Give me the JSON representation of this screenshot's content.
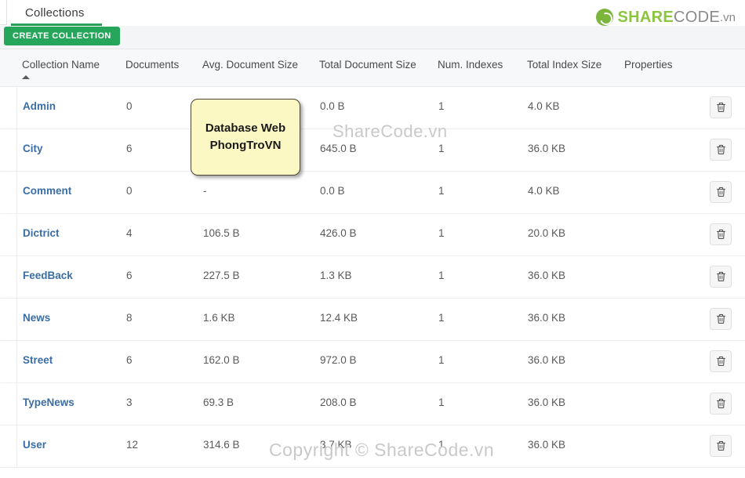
{
  "tab": {
    "label": "Collections"
  },
  "logo": {
    "mark": "sharecode-logo-icon",
    "share": "SHARE",
    "code": "CODE",
    "vn": ".vn",
    "green": "#8cc63e",
    "gray": "#8a8a8a"
  },
  "toolbar": {
    "create_label": "CREATE COLLECTION",
    "accent": "#26a65b"
  },
  "table": {
    "columns": [
      "Collection Name",
      "Documents",
      "Avg. Document Size",
      "Total Document Size",
      "Num. Indexes",
      "Total Index Size",
      "Properties"
    ],
    "sort": {
      "column": "Collection Name",
      "direction": "asc"
    },
    "delete_icon": "trash-icon",
    "rows": [
      {
        "name": "Admin",
        "documents": "0",
        "avg_size": "",
        "total_size": "0.0 B",
        "num_indexes": "1",
        "index_size": "4.0 KB",
        "properties": ""
      },
      {
        "name": "City",
        "documents": "6",
        "avg_size": "",
        "total_size": "645.0 B",
        "num_indexes": "1",
        "index_size": "36.0 KB",
        "properties": ""
      },
      {
        "name": "Comment",
        "documents": "0",
        "avg_size": "-",
        "total_size": "0.0 B",
        "num_indexes": "1",
        "index_size": "4.0 KB",
        "properties": ""
      },
      {
        "name": "Dictrict",
        "documents": "4",
        "avg_size": "106.5 B",
        "total_size": "426.0 B",
        "num_indexes": "1",
        "index_size": "20.0 KB",
        "properties": ""
      },
      {
        "name": "FeedBack",
        "documents": "6",
        "avg_size": "227.5 B",
        "total_size": "1.3 KB",
        "num_indexes": "1",
        "index_size": "36.0 KB",
        "properties": ""
      },
      {
        "name": "News",
        "documents": "8",
        "avg_size": "1.6 KB",
        "total_size": "12.4 KB",
        "num_indexes": "1",
        "index_size": "36.0 KB",
        "properties": ""
      },
      {
        "name": "Street",
        "documents": "6",
        "avg_size": "162.0 B",
        "total_size": "972.0 B",
        "num_indexes": "1",
        "index_size": "36.0 KB",
        "properties": ""
      },
      {
        "name": "TypeNews",
        "documents": "3",
        "avg_size": "69.3 B",
        "total_size": "208.0 B",
        "num_indexes": "1",
        "index_size": "36.0 KB",
        "properties": ""
      },
      {
        "name": "User",
        "documents": "12",
        "avg_size": "314.6 B",
        "total_size": "3.7 KB",
        "num_indexes": "1",
        "index_size": "36.0 KB",
        "properties": ""
      }
    ]
  },
  "sticky_note": {
    "text": "Database Web PhongTroVN",
    "background": "#fbf8c4"
  },
  "watermarks": {
    "middle": "ShareCode.vn",
    "bottom": "Copyright © ShareCode.vn"
  }
}
